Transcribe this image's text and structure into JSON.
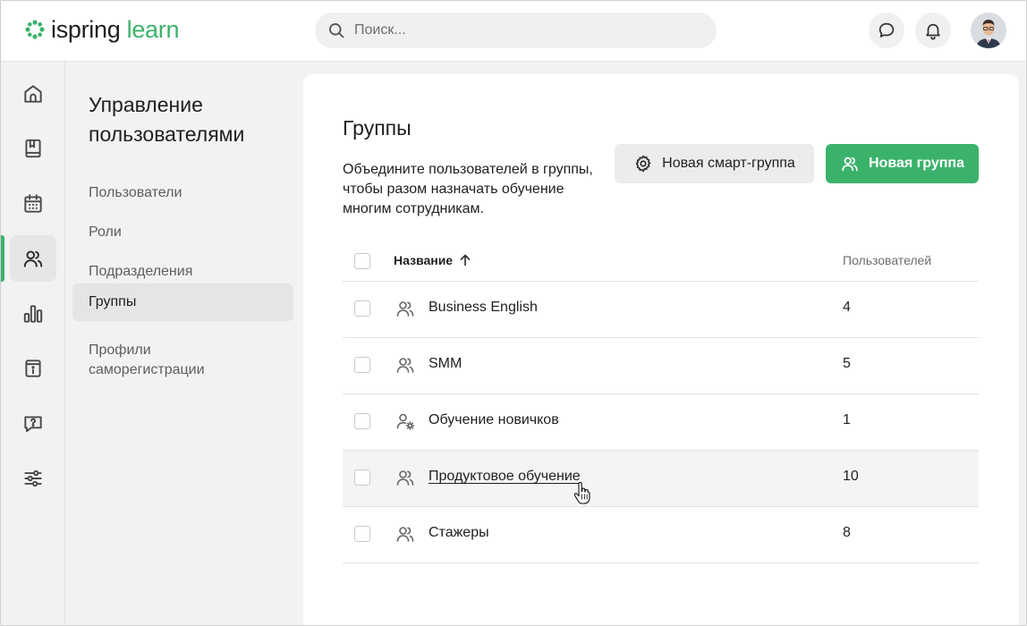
{
  "header": {
    "logo": {
      "part1": "ispring",
      "part2": "learn",
      "brand_color": "#3bb26b"
    },
    "search": {
      "placeholder": "Поиск...",
      "value": ""
    },
    "icons": [
      "chat-bubble-icon",
      "bell-icon"
    ],
    "avatar": "user-avatar"
  },
  "rail": {
    "items": [
      {
        "icon": "home-icon"
      },
      {
        "icon": "book-icon"
      },
      {
        "icon": "calendar-icon"
      },
      {
        "icon": "users-icon",
        "active": true
      },
      {
        "icon": "bar-chart-icon"
      },
      {
        "icon": "info-book-icon"
      },
      {
        "icon": "question-chat-icon"
      },
      {
        "icon": "sliders-icon"
      }
    ]
  },
  "subnav": {
    "title": "Управление пользователями",
    "items": [
      {
        "label": "Пользователи"
      },
      {
        "label": "Роли"
      },
      {
        "label": "Подразделения"
      },
      {
        "label": "Группы",
        "active": true
      },
      {
        "label": "Профили саморегистрации"
      }
    ]
  },
  "main": {
    "title": "Группы",
    "description": "Объедините пользователей в группы, чтобы разом назначать обучение многим сотрудникам.",
    "smart_group_button": "Новая смарт-группа",
    "new_group_button": "Новая группа",
    "table": {
      "col_name": "Название",
      "col_users": "Пользователей",
      "rows": [
        {
          "name": "Business English",
          "count": "4",
          "icon": "users-icon"
        },
        {
          "name": "SMM",
          "count": "5",
          "icon": "users-icon"
        },
        {
          "name": "Обучение новичков",
          "count": "1",
          "icon": "smart-group-icon"
        },
        {
          "name": "Продуктовое обучение",
          "count": "10",
          "icon": "users-icon",
          "hover": true
        },
        {
          "name": "Стажеры",
          "count": "8",
          "icon": "users-icon"
        }
      ]
    }
  }
}
